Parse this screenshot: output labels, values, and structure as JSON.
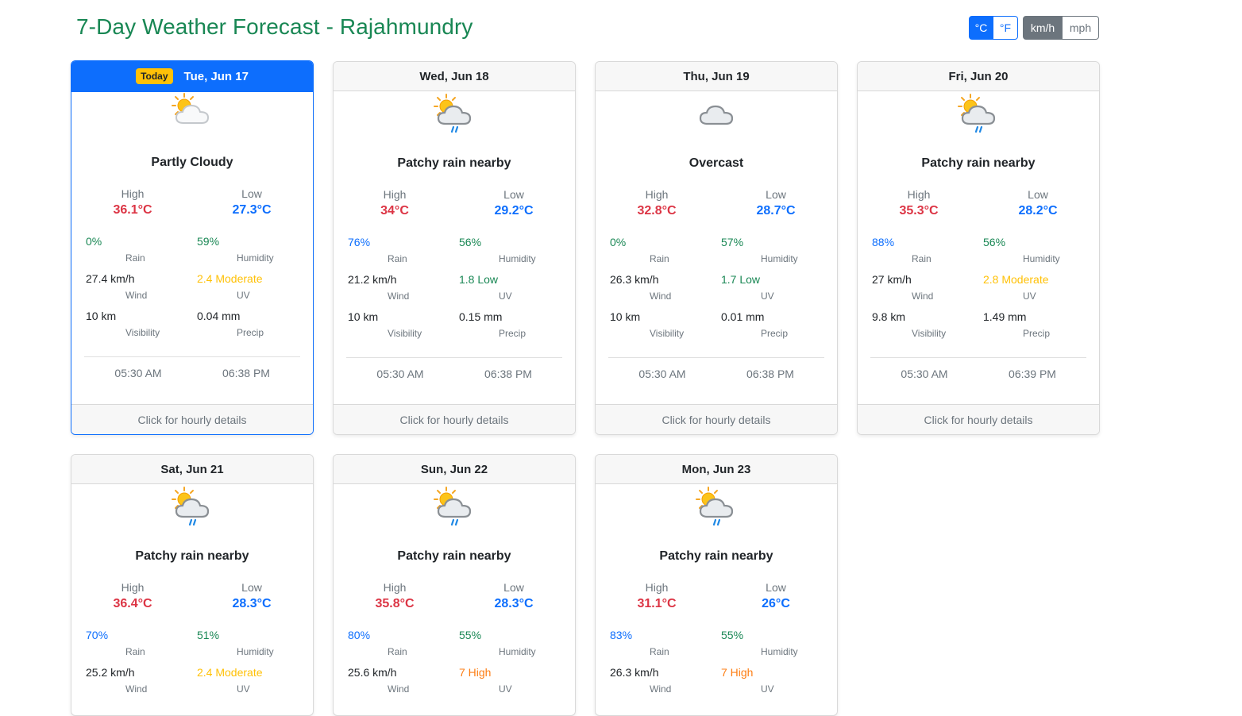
{
  "title": "7-Day Weather Forecast - Rajahmundry",
  "units": {
    "celsius": "°C",
    "fahrenheit": "°F",
    "kmh": "km/h",
    "mph": "mph"
  },
  "labels": {
    "today_badge": "Today",
    "high": "High",
    "low": "Low",
    "rain": "Rain",
    "humidity": "Humidity",
    "wind": "Wind",
    "uv": "UV",
    "visibility": "Visibility",
    "precip": "Precip",
    "footer": "Click for hourly details"
  },
  "colors": {
    "primary": "#0d6efd",
    "success": "#198754",
    "danger": "#dc3545",
    "warning": "#ffc107",
    "orange": "#fd7e14",
    "secondary": "#6c757d"
  },
  "days": [
    {
      "date": "Tue, Jun 17",
      "icon": "partly-cloudy-icon",
      "condition": "Partly Cloudy",
      "high": "36.1°C",
      "low": "27.3°C",
      "rain": "0%",
      "humidity": "59%",
      "wind": "27.4 km/h",
      "uv": "2.4 Moderate",
      "visibility": "10 km",
      "precip": "0.04 mm",
      "sunrise": "05:30 AM",
      "sunset": "06:38 PM"
    },
    {
      "date": "Wed, Jun 18",
      "icon": "patchy-rain-icon",
      "condition": "Patchy rain nearby",
      "high": "34°C",
      "low": "29.2°C",
      "rain": "76%",
      "humidity": "56%",
      "wind": "21.2 km/h",
      "uv": "1.8 Low",
      "visibility": "10 km",
      "precip": "0.15 mm",
      "sunrise": "05:30 AM",
      "sunset": "06:38 PM"
    },
    {
      "date": "Thu, Jun 19",
      "icon": "overcast-icon",
      "condition": "Overcast",
      "high": "32.8°C",
      "low": "28.7°C",
      "rain": "0%",
      "humidity": "57%",
      "wind": "26.3 km/h",
      "uv": "1.7 Low",
      "visibility": "10 km",
      "precip": "0.01 mm",
      "sunrise": "05:30 AM",
      "sunset": "06:38 PM"
    },
    {
      "date": "Fri, Jun 20",
      "icon": "patchy-rain-icon",
      "condition": "Patchy rain nearby",
      "high": "35.3°C",
      "low": "28.2°C",
      "rain": "88%",
      "humidity": "56%",
      "wind": "27 km/h",
      "uv": "2.8 Moderate",
      "visibility": "9.8 km",
      "precip": "1.49 mm",
      "sunrise": "05:30 AM",
      "sunset": "06:39 PM"
    },
    {
      "date": "Sat, Jun 21",
      "icon": "patchy-rain-icon",
      "condition": "Patchy rain nearby",
      "high": "36.4°C",
      "low": "28.3°C",
      "rain": "70%",
      "humidity": "51%",
      "wind": "25.2 km/h",
      "uv": "2.4 Moderate"
    },
    {
      "date": "Sun, Jun 22",
      "icon": "patchy-rain-icon",
      "condition": "Patchy rain nearby",
      "high": "35.8°C",
      "low": "28.3°C",
      "rain": "80%",
      "humidity": "55%",
      "wind": "25.6 km/h",
      "uv": "7 High"
    },
    {
      "date": "Mon, Jun 23",
      "icon": "patchy-rain-icon",
      "condition": "Patchy rain nearby",
      "high": "31.1°C",
      "low": "26°C",
      "rain": "83%",
      "humidity": "55%",
      "wind": "26.3 km/h",
      "uv": "7 High"
    }
  ]
}
